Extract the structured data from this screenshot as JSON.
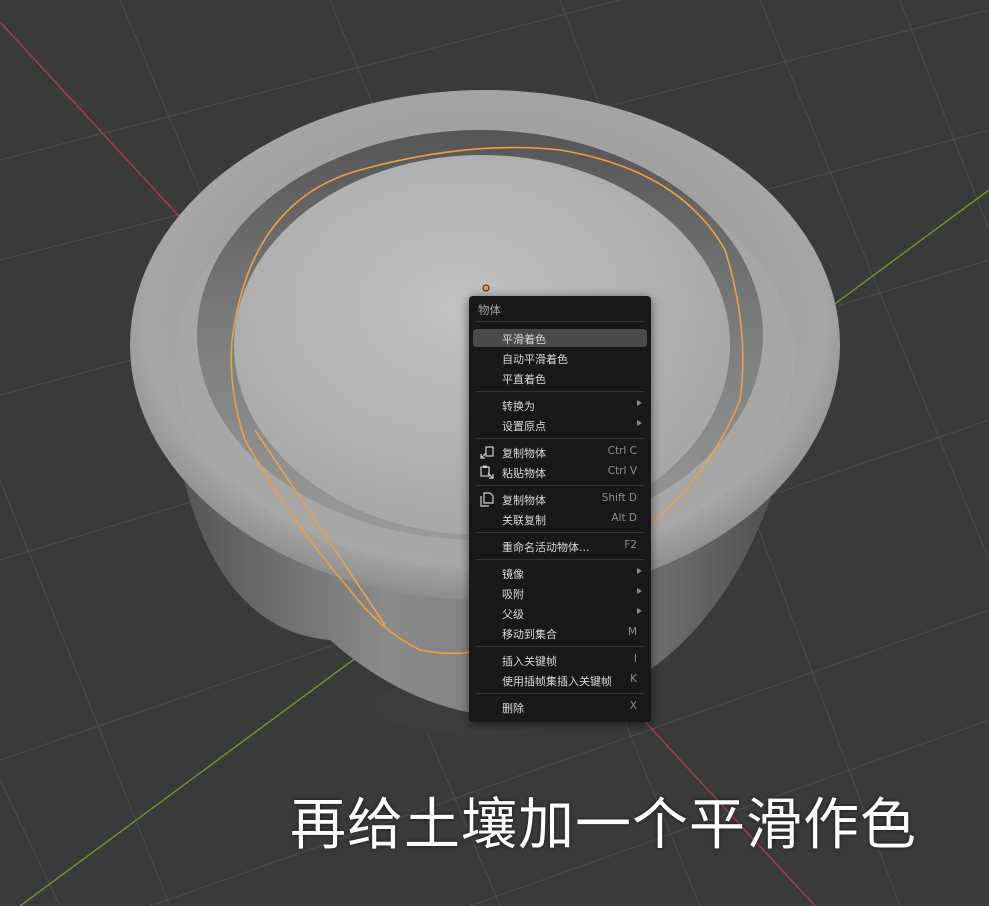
{
  "menu": {
    "title": "物体",
    "items": [
      {
        "label": "平滑着色",
        "shortcut": "",
        "submenu": false
      },
      {
        "label": "自动平滑着色",
        "shortcut": "",
        "submenu": false
      },
      {
        "label": "平直着色",
        "shortcut": "",
        "submenu": false
      },
      {
        "label": "转换为",
        "shortcut": "",
        "submenu": true
      },
      {
        "label": "设置原点",
        "shortcut": "",
        "submenu": true
      },
      {
        "label": "复制物体",
        "shortcut": "Ctrl C",
        "submenu": false,
        "icon": "copy-icon"
      },
      {
        "label": "粘贴物体",
        "shortcut": "Ctrl V",
        "submenu": false,
        "icon": "paste-icon"
      },
      {
        "label": "复制物体",
        "shortcut": "Shift D",
        "submenu": false,
        "icon": "duplicate-icon"
      },
      {
        "label": "关联复制",
        "shortcut": "Alt D",
        "submenu": false
      },
      {
        "label": "重命名活动物体...",
        "shortcut": "F2",
        "submenu": false
      },
      {
        "label": "镜像",
        "shortcut": "",
        "submenu": true
      },
      {
        "label": "吸附",
        "shortcut": "",
        "submenu": true
      },
      {
        "label": "父级",
        "shortcut": "",
        "submenu": true
      },
      {
        "label": "移动到集合",
        "shortcut": "M",
        "submenu": false
      },
      {
        "label": "插入关键帧",
        "shortcut": "I",
        "submenu": false
      },
      {
        "label": "使用插帧集插入关键帧",
        "shortcut": "K",
        "submenu": false
      },
      {
        "label": "删除",
        "shortcut": "X",
        "submenu": false
      }
    ]
  },
  "caption": "再给土壤加一个平滑作色",
  "colors": {
    "viewport_bg": "#3a3a3a",
    "menu_bg": "#181818",
    "menu_hover": "#4a4a4a",
    "selection_outline": "#f0a040",
    "x_axis": "#b23a48",
    "y_axis": "#6a9a2a"
  }
}
